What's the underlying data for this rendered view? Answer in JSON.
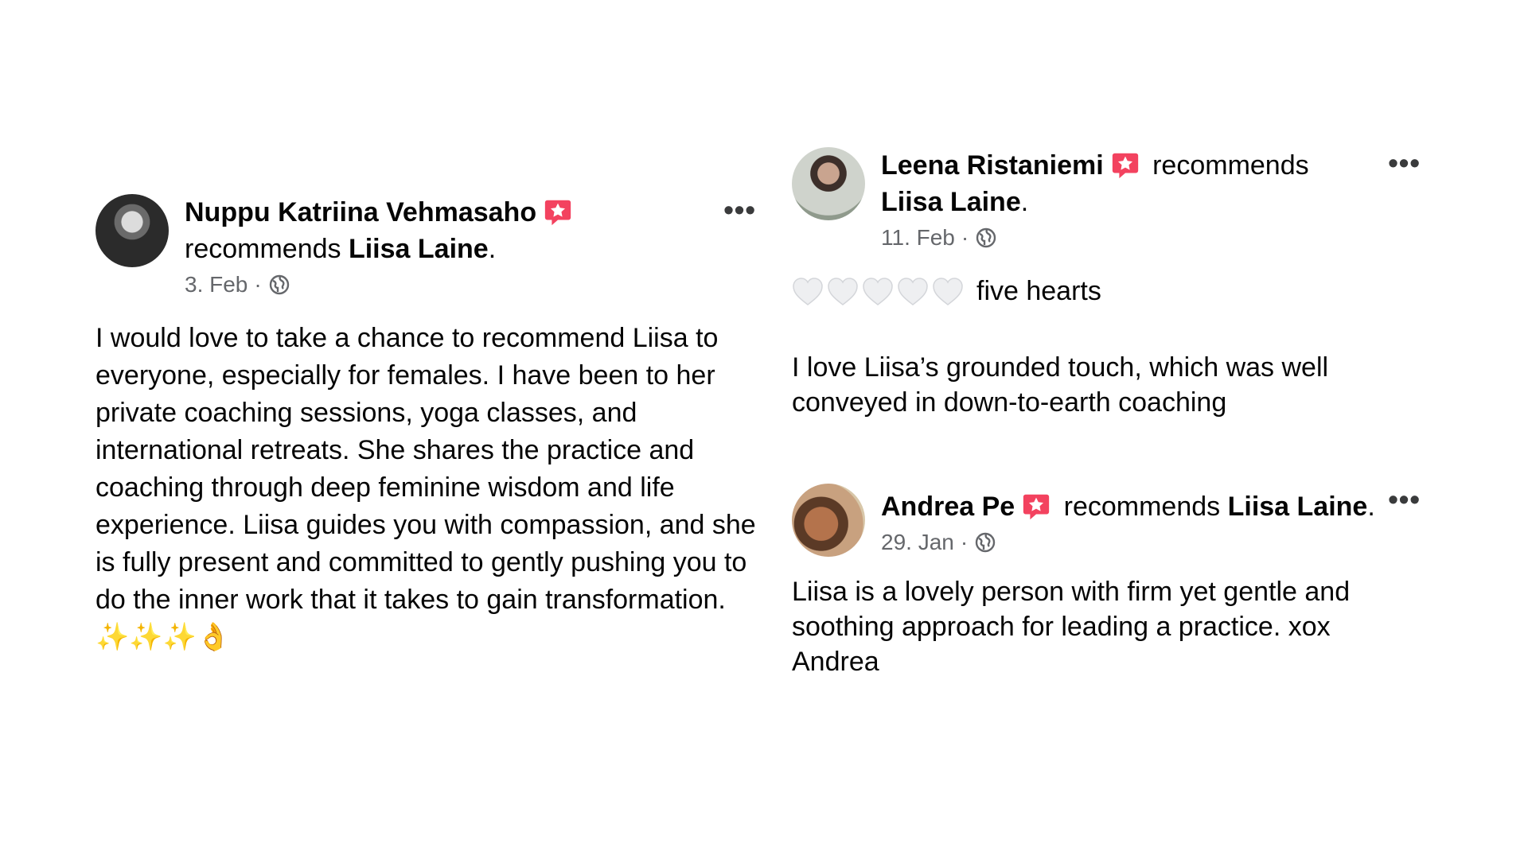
{
  "reviews": [
    {
      "author": "Nuppu Katriina Vehmasaho",
      "recommends": "recommends",
      "target": "Liisa Laine",
      "period": ".",
      "date": "3. Feb",
      "separator": "·",
      "body": "I would love to take a chance to recommend Liisa to everyone, especially for females. I have been to her private coaching sessions, yoga classes, and international retreats. She shares the practice and coaching through deep feminine wisdom and life experience. Liisa guides you with compassion, and she is fully present and committed to gently pushing you to do the inner work that it takes to gain transformation.",
      "emojis": "✨✨✨👌",
      "more": "•••"
    },
    {
      "author": "Leena Ristaniemi",
      "recommends": "recommends",
      "target": "Liisa Laine",
      "period": ".",
      "date": "11. Feb",
      "separator": "·",
      "hearts_count": 5,
      "hearts_label": "five hearts",
      "body": "I love Liisa’s grounded touch, which was well conveyed in down-to-earth coaching",
      "more": "•••"
    },
    {
      "author": "Andrea Pe",
      "recommends": "recommends",
      "target": "Liisa Laine",
      "period": ".",
      "date": "29. Jan",
      "separator": "·",
      "body": "Liisa is a lovely person with firm yet gentle and soothing approach for leading a practice. xox Andrea",
      "more": "•••"
    }
  ],
  "colors": {
    "badge": "#f3425f",
    "meta": "#65676b",
    "heart": "#e4e6eb"
  },
  "icons": {
    "badge": "recommendation-badge-icon",
    "globe": "globe-icon",
    "heart": "white-heart-icon",
    "more": "more-options-icon"
  }
}
